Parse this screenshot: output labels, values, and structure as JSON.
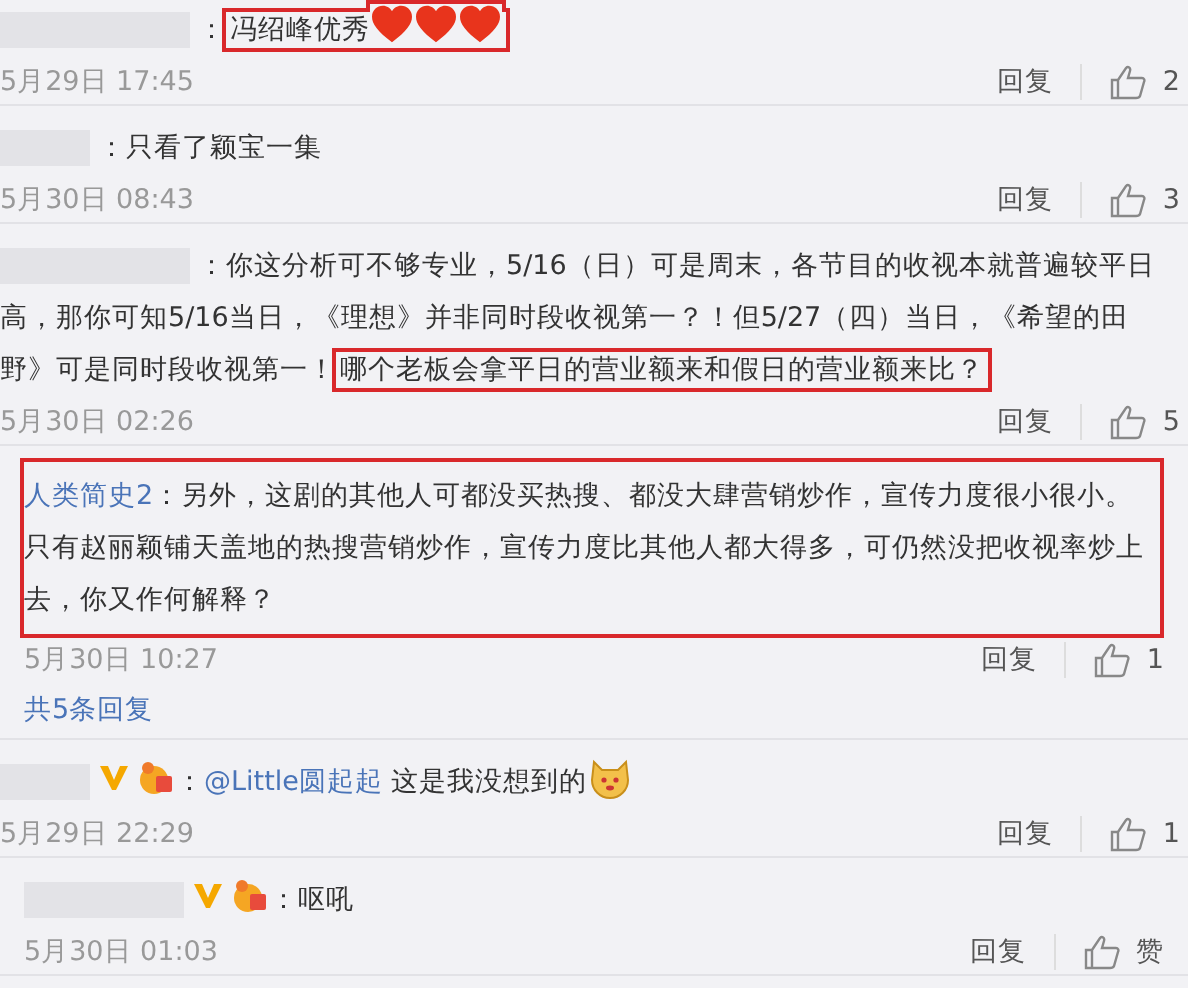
{
  "comments": [
    {
      "kind": "top",
      "name_blurred": true,
      "highlighted": false,
      "separator": "：",
      "segments": [
        {
          "kind": "text",
          "text": "冯绍峰优秀",
          "highlight": true
        },
        {
          "kind": "heart",
          "highlight": true
        },
        {
          "kind": "heart",
          "highlight": true
        },
        {
          "kind": "heart",
          "highlight": true
        }
      ],
      "date": "5月29日 17:45",
      "reply": "回复",
      "likes": "2"
    },
    {
      "kind": "top",
      "name_blurred": true,
      "highlighted": false,
      "separator": "：",
      "segments": [
        {
          "kind": "text",
          "text": "只看了颖宝一集",
          "highlight": false
        }
      ],
      "date": "5月30日 08:43",
      "reply": "回复",
      "likes": "3"
    },
    {
      "kind": "top",
      "name_blurred": true,
      "highlighted": false,
      "separator": "：",
      "segments": [
        {
          "kind": "text",
          "text": "你这分析可不够专业，5/16（日）可是周末，各节目的收视本就普遍较平日高，那你可知5/16当日，《理想》并非同时段收视第一？！但5/27（四）当日，《希望的田野》可是同时段收视第一！",
          "highlight": false
        },
        {
          "kind": "text",
          "text": "哪个老板会拿平日的营业额来和假日的营业额来比？",
          "highlight": true
        }
      ],
      "date": "5月30日 02:26",
      "reply": "回复",
      "likes": "5"
    },
    {
      "kind": "reply",
      "name": "人类简史2",
      "highlighted": true,
      "separator": "：",
      "segments": [
        {
          "kind": "text",
          "text": "另外，这剧的其他人可都没买热搜、都没大肆营销炒作，宣传力度很小很小。只有赵丽颖铺天盖地的热搜营销炒作，宣传力度比其他人都大得多，可仍然没把收视率炒上去，你又作何解释？",
          "highlight": false
        }
      ],
      "date": "5月30日 10:27",
      "reply": "回复",
      "likes": "1",
      "more_replies": "共5条回复"
    },
    {
      "kind": "top",
      "name_blurred": true,
      "verified": true,
      "badge": true,
      "highlighted": false,
      "separator": "：",
      "segments": [
        {
          "kind": "mention",
          "text": "@Little圆起起",
          "highlight": false
        },
        {
          "kind": "text",
          "text": " 这是我没想到的",
          "highlight": false
        },
        {
          "kind": "dog",
          "highlight": false
        }
      ],
      "date": "5月29日 22:29",
      "reply": "回复",
      "likes": "1"
    },
    {
      "kind": "reply",
      "name_blurred": true,
      "verified": true,
      "badge": true,
      "highlighted": false,
      "separator": "：",
      "segments": [
        {
          "kind": "text",
          "text": "呕吼",
          "highlight": false
        }
      ],
      "date": "5月30日 01:03",
      "reply": "回复",
      "likes": "赞"
    }
  ]
}
